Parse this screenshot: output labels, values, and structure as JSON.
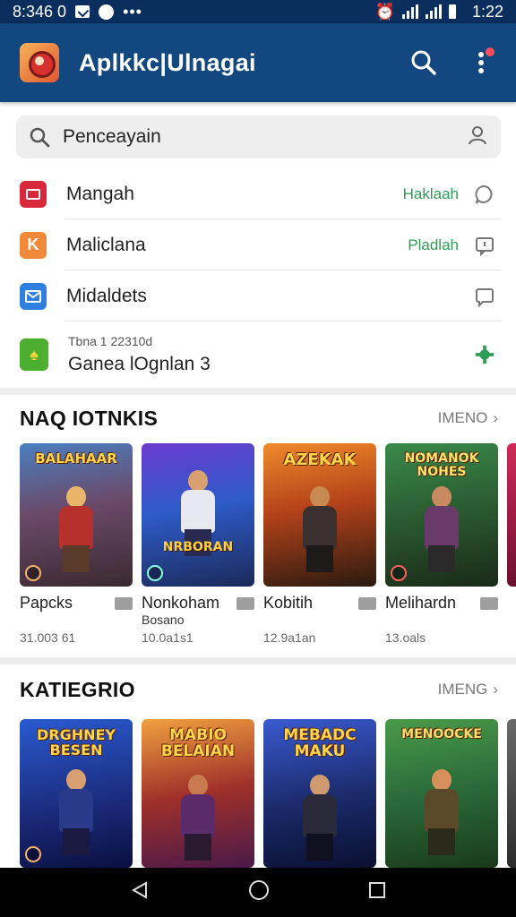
{
  "status_bar": {
    "time_left": "8:346 0",
    "clock": "1:22"
  },
  "app_bar": {
    "title": "Aplkkc|Ulnagai"
  },
  "search": {
    "value": "Penceayain"
  },
  "menu": [
    {
      "label": "Mangah",
      "badge": "Haklaah"
    },
    {
      "label": "Maliclana",
      "badge": "Pladlah"
    },
    {
      "label": "Midaldets",
      "badge": ""
    },
    {
      "sub": "Tbna 1 22310d",
      "label": "Ganea lOgnlan 3",
      "badge": ""
    }
  ],
  "section1": {
    "title": "NAQ IOTNKIS",
    "more": "IMENO",
    "cards": [
      {
        "name": "Papcks",
        "sub": "",
        "meta": "31.003 61",
        "art_title": "BALAHAAR",
        "art_sub": ""
      },
      {
        "name": "Nonkoham",
        "sub": "Bosano",
        "meta": "10.0a1s1",
        "art_title": "",
        "art_sub": "NRBORAN"
      },
      {
        "name": "Kobitih",
        "sub": "",
        "meta": "12.9a1an",
        "art_title": "AZEKAK",
        "art_sub": ""
      },
      {
        "name": "Melihardn",
        "sub": "",
        "meta": "13.oals",
        "art_title": "NOMANOK NOHES",
        "art_sub": ""
      }
    ]
  },
  "section2": {
    "title": "KATIEGRIO",
    "more": "IMENG",
    "cards": [
      {
        "art_title": "DRGHNEY BESEN"
      },
      {
        "art_title": "MABIO BELAIAN"
      },
      {
        "art_title": "MEBADC MAKU"
      },
      {
        "art_title": "MENOOCKE"
      }
    ]
  },
  "colors": {
    "app_bar": "#12477f",
    "status_bar": "#0a2f5e",
    "accent_green": "#2e9d55"
  }
}
